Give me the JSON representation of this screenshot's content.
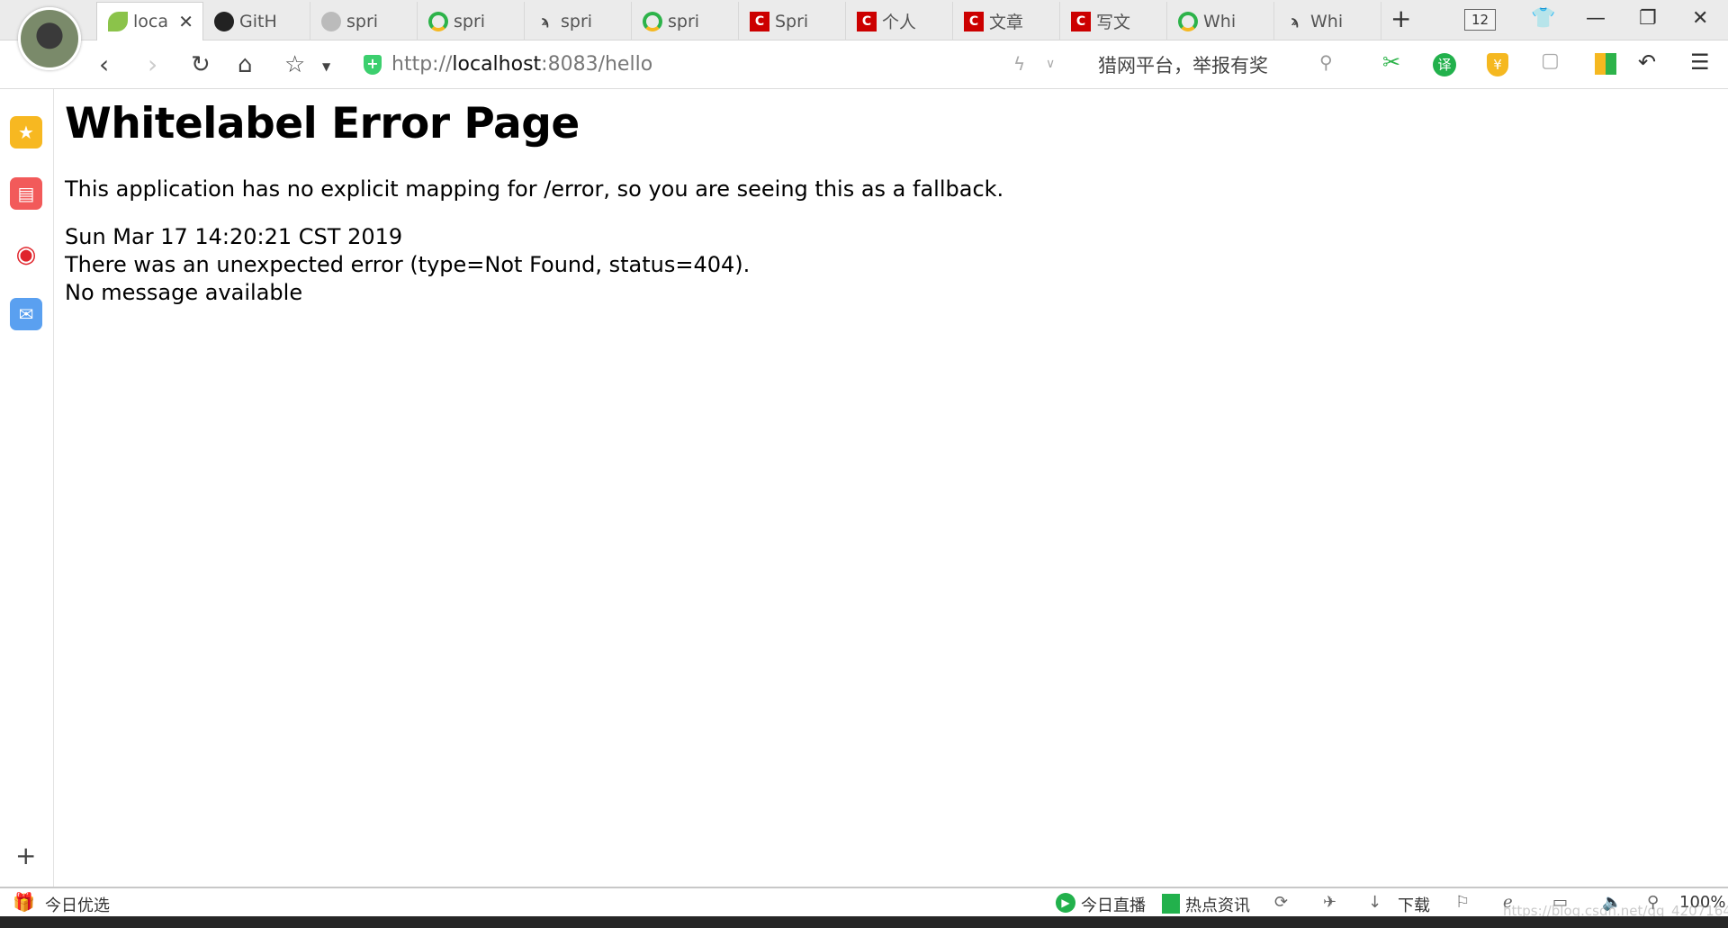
{
  "browser": {
    "tabs": [
      {
        "label": "loca",
        "icon": "spring-leaf-icon",
        "active": true
      },
      {
        "label": "GitH",
        "icon": "github-icon"
      },
      {
        "label": "spri",
        "icon": "mascot-icon"
      },
      {
        "label": "spri",
        "icon": "circle-logo-icon"
      },
      {
        "label": "spri",
        "icon": "feather-icon"
      },
      {
        "label": "spri",
        "icon": "circle-logo-icon"
      },
      {
        "label": "Spri",
        "icon": "csdn-icon"
      },
      {
        "label": "个人",
        "icon": "csdn-icon"
      },
      {
        "label": "文章",
        "icon": "csdn-icon"
      },
      {
        "label": "写文",
        "icon": "csdn-icon"
      },
      {
        "label": "Whi",
        "icon": "circle-logo-icon"
      },
      {
        "label": "Whi",
        "icon": "feather-icon"
      }
    ],
    "tab_count": "12",
    "url_prefix": "http://",
    "url_host": "localhost",
    "url_rest": ":8083/hello",
    "search_placeholder": "猎网平台，举报有奖",
    "zoom": "100%"
  },
  "page": {
    "title": "Whitelabel Error Page",
    "description": "This application has no explicit mapping for /error, so you are seeing this as a fallback.",
    "timestamp": "Sun Mar 17 14:20:21 CST 2019",
    "error": "There was an unexpected error (type=Not Found, status=404).",
    "message": "No message available"
  },
  "statusbar": {
    "left": "今日优选",
    "live": "今日直播",
    "news": "热点资讯",
    "download": "下载",
    "watermark": "https://blog.csdn.net/qq_42071644"
  }
}
